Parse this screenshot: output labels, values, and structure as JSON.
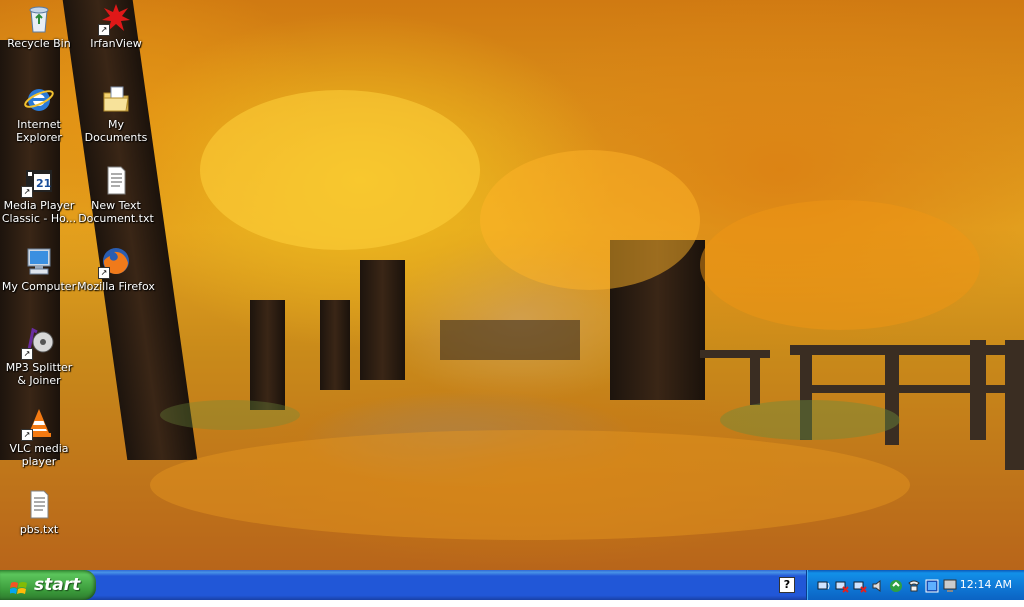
{
  "desktop": {
    "icons": [
      {
        "label": "Recycle Bin",
        "icon": "recycle-bin-icon"
      },
      {
        "label": "IrfanView",
        "icon": "irfanview-icon"
      },
      {
        "label": "Internet Explorer",
        "icon": "internet-explorer-icon"
      },
      {
        "label": "My Documents",
        "icon": "my-documents-icon"
      },
      {
        "label": "Media Player Classic - Ho...",
        "icon": "media-player-classic-icon"
      },
      {
        "label": "New Text Document.txt",
        "icon": "text-document-icon"
      },
      {
        "label": "My Computer",
        "icon": "my-computer-icon"
      },
      {
        "label": "Mozilla Firefox",
        "icon": "firefox-icon"
      },
      {
        "label": "MP3 Splitter & Joiner",
        "icon": "mp3-splitter-icon"
      },
      {
        "label": "VLC media player",
        "icon": "vlc-icon"
      },
      {
        "label": "pbs.txt",
        "icon": "text-document-icon"
      }
    ]
  },
  "taskbar": {
    "start_label": "start",
    "help_icon_text": "?",
    "clock": "12:14 AM"
  },
  "colors": {
    "taskbar_blue": "#2157d7",
    "start_green": "#3c9e3c",
    "tray_blue": "#0f7bd8"
  }
}
